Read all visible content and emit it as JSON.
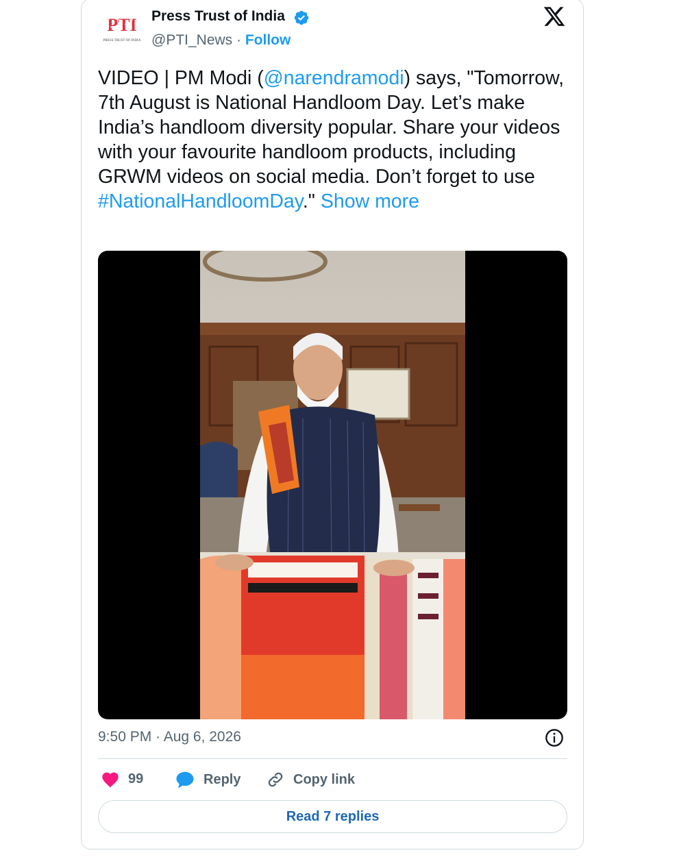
{
  "author": {
    "name": "Press Trust of India",
    "handle": "@PTI_News",
    "separator": " · ",
    "follow_label": "Follow",
    "logo_text": "PTI",
    "logo_subtext": "PRESS TRUST OF INDIA"
  },
  "tweet": {
    "p1": "VIDEO | PM Modi (",
    "mention": "@narendramodi",
    "p2": ") says, \"Tomorrow, 7th August is National Handloom Day. Let’s make India’s handloom diversity popular. Share your videos with your favourite handloom products, including GRWM videos on social media. Don’t forget to use ",
    "hashtag": "#NationalHandloomDay",
    "p3": ".\" ",
    "show_more": "Show more"
  },
  "timestamp": "9:50 PM · Aug 6, 2026",
  "actions": {
    "likes": "99",
    "reply_label": "Reply",
    "copy_link_label": "Copy link"
  },
  "read_replies_label": "Read 7 replies",
  "colors": {
    "accent": "#1d9bf0",
    "like": "#f91880",
    "secondary_text": "#536471",
    "border": "#cfd9de"
  }
}
